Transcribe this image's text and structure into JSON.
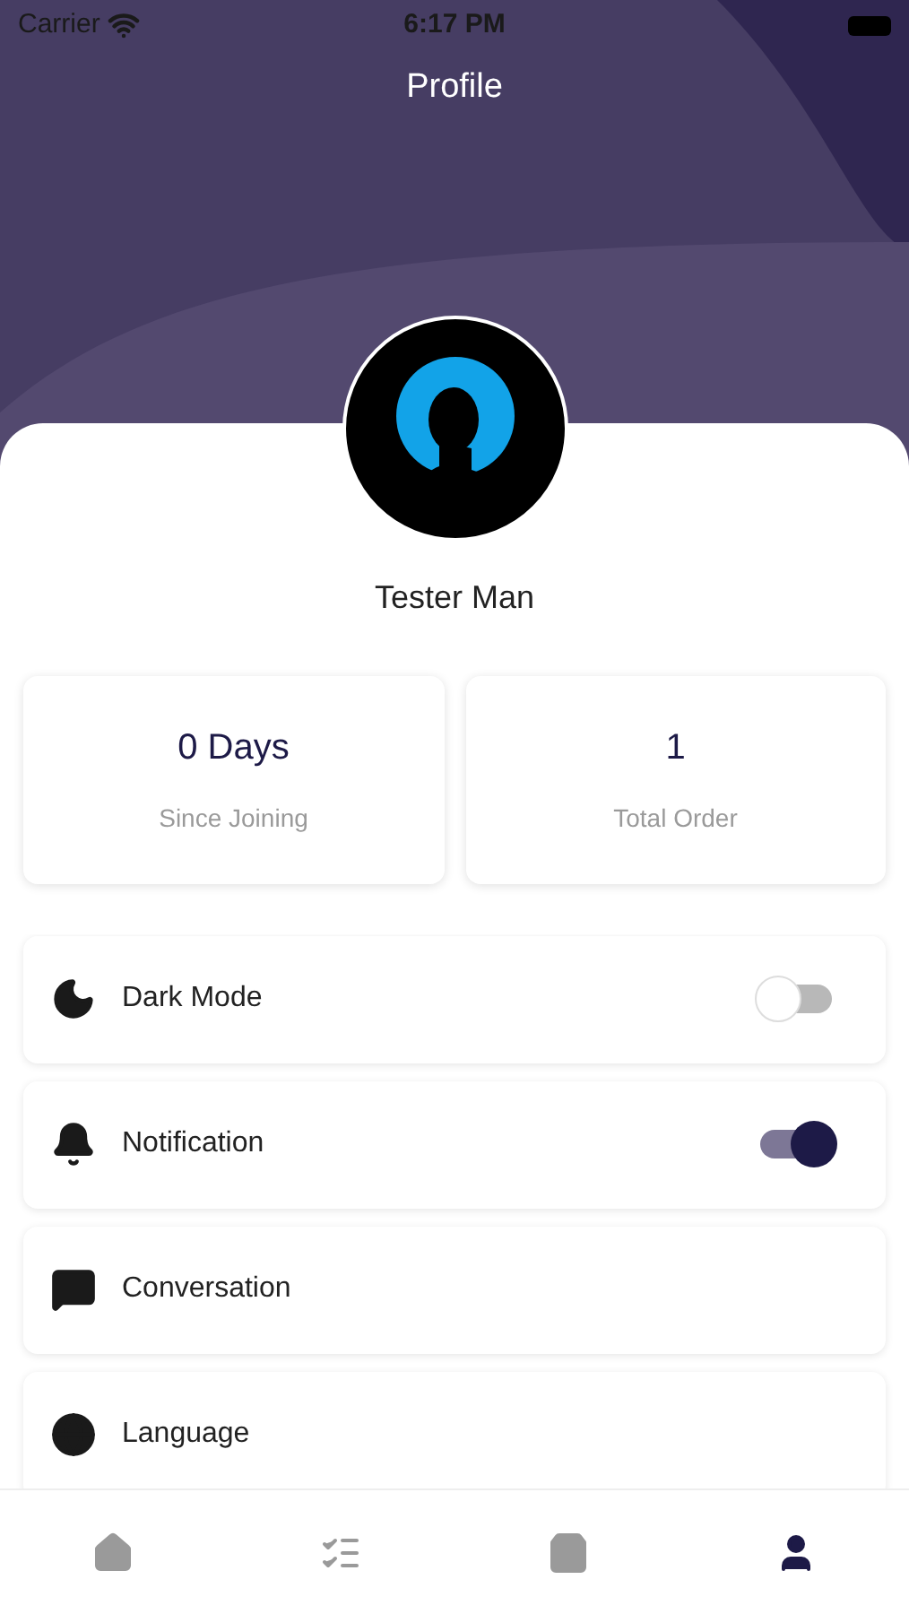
{
  "status_bar": {
    "carrier": "Carrier",
    "time": "6:17 PM"
  },
  "header": {
    "title": "Profile"
  },
  "profile": {
    "name": "Tester Man"
  },
  "stats": [
    {
      "value": "0 Days",
      "label": "Since Joining"
    },
    {
      "value": "1",
      "label": "Total Order"
    }
  ],
  "settings": [
    {
      "kind": "toggle",
      "label": "Dark Mode",
      "on": false
    },
    {
      "kind": "toggle",
      "label": "Notification",
      "on": true
    },
    {
      "kind": "link",
      "label": "Conversation"
    },
    {
      "kind": "link",
      "label": "Language"
    }
  ],
  "tab_bar": [
    {
      "selected": false
    },
    {
      "selected": false
    },
    {
      "selected": false
    },
    {
      "selected": true
    }
  ]
}
